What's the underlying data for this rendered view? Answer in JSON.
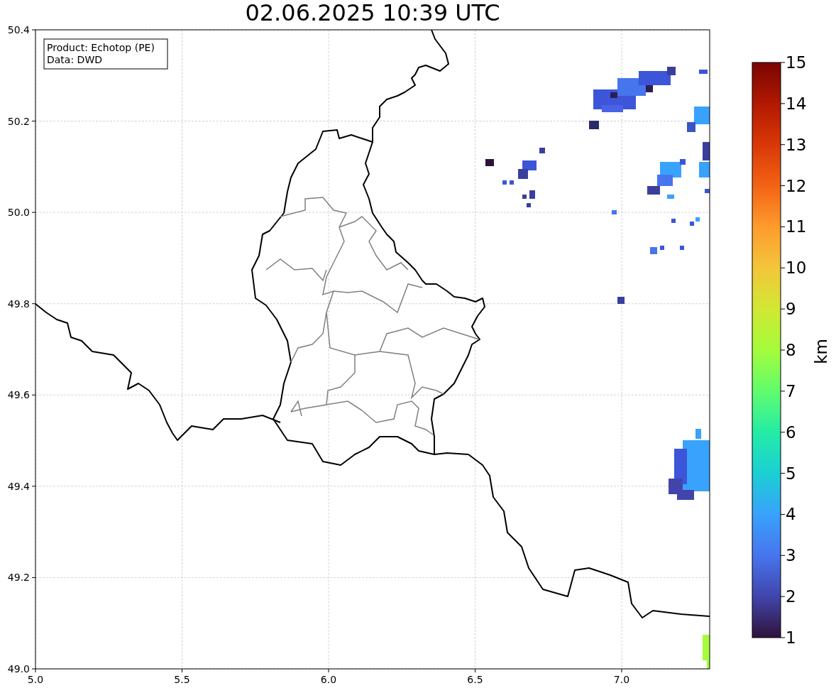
{
  "title": "02.06.2025 10:39 UTC",
  "map": {
    "info_box": [
      "Product: Echotop (PE)",
      "Data: DWD"
    ],
    "x_ticks": [
      "5.0",
      "5.5",
      "6.0",
      "6.5",
      "7.0"
    ],
    "y_ticks": [
      "50.4",
      "50.2",
      "50.0",
      "49.8",
      "49.6",
      "49.4",
      "49.2",
      "49.0"
    ]
  },
  "colorbar": {
    "ticks": [
      "15",
      "14",
      "13",
      "12",
      "11",
      "10",
      "9",
      "8",
      "7",
      "6",
      "5",
      "4",
      "3",
      "2",
      "1"
    ],
    "label": "km"
  }
}
